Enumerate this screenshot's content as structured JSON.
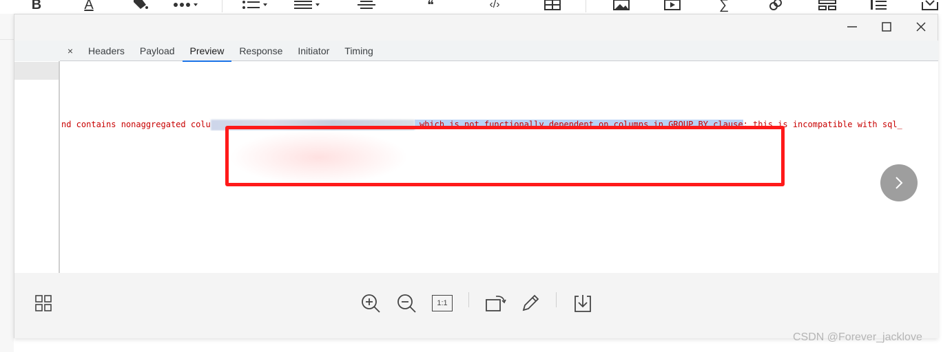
{
  "editor_toolbar": {
    "icons": [
      "bold-icon",
      "font-color-icon",
      "highlight-fill-icon",
      "more-icon",
      "bulleted-list-icon",
      "align-icon",
      "indent-icon",
      "quote-icon",
      "code-icon",
      "table-icon",
      "image-icon",
      "video-icon",
      "formula-icon",
      "link-icon",
      "template-icon",
      "outline-icon",
      "save-draft-icon"
    ],
    "bold_glyph": "B",
    "font_color_glyph": "A",
    "quote_glyph": "❝",
    "code_glyph": "‹/›",
    "formula_glyph": "∑"
  },
  "window": {
    "minimize_glyph": "—",
    "maximize_glyph": "☐",
    "close_glyph": "✕"
  },
  "devtools": {
    "close_glyph": "×",
    "tabs": [
      "Headers",
      "Payload",
      "Preview",
      "Response",
      "Initiator",
      "Timing"
    ],
    "active_tab": "Preview",
    "error_prefix": "nd contains nonaggregated colu",
    "error_selected": " which is not functionally dependent on columns in GROUP BY clause",
    "error_suffix": "; this is incompatible with sql_"
  },
  "viewer": {
    "next_glyph": "›",
    "bottom_icons": [
      "thumbnails-icon",
      "zoom-in-icon",
      "zoom-out-icon",
      "actual-size-icon",
      "rotate-icon",
      "edit-pencil-icon",
      "download-icon"
    ],
    "actual_size_label": "1:1"
  },
  "colors": {
    "error_text": "#c80000",
    "highlight_border": "#ff1a1a",
    "selection": "#b7d2f6",
    "active_tab_underline": "#1a73e8"
  },
  "watermark": "CSDN @Forever_jacklove"
}
